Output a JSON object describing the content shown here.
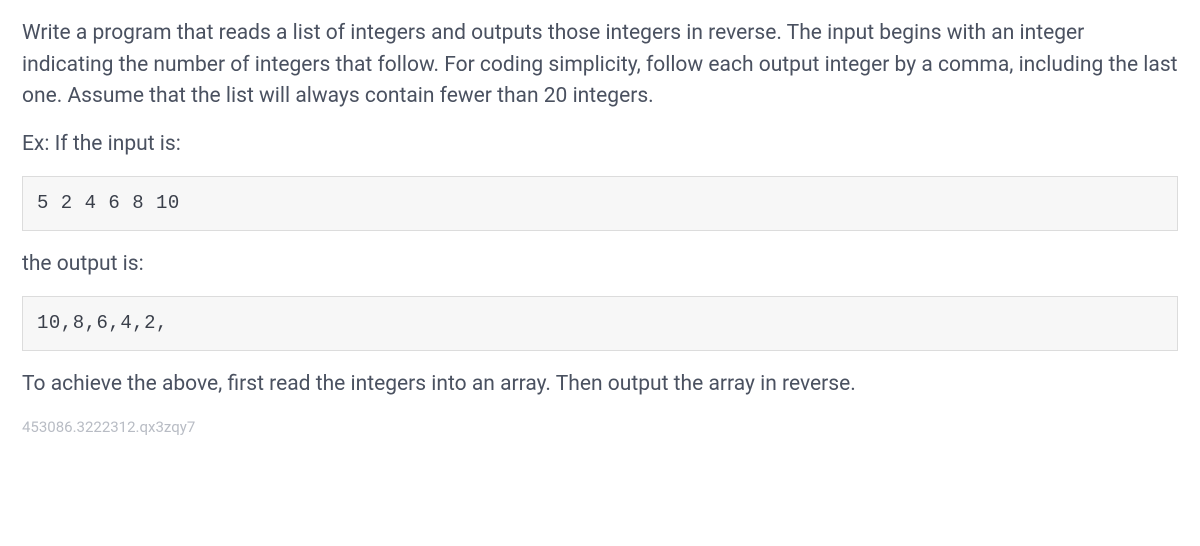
{
  "problem": {
    "description": "Write a program that reads a list of integers and outputs those integers in reverse. The input begins with an integer indicating the number of integers that follow. For coding simplicity, follow each output integer by a comma, including the last one. Assume that the list will always contain fewer than 20 integers.",
    "example_intro": "Ex: If the input is:",
    "example_input": "5 2 4 6 8 10",
    "output_label": "the output is:",
    "example_output": "10,8,6,4,2,",
    "instruction": "To achieve the above, first read the integers into an array. Then output the array in reverse.",
    "footer_id": "453086.3222312.qx3zqy7"
  }
}
